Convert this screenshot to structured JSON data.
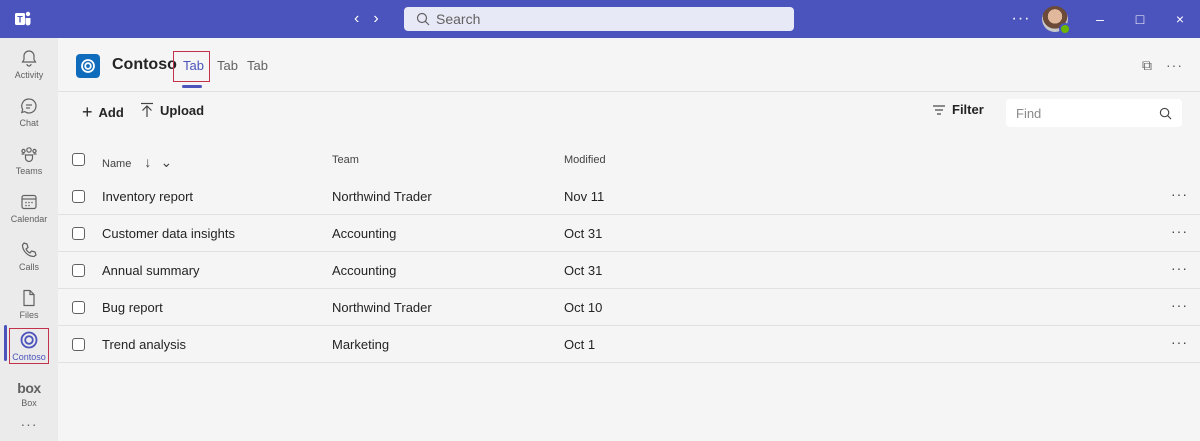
{
  "titlebar": {
    "nav_back": "‹",
    "nav_forward": "›",
    "search_placeholder": "Search",
    "more": "···",
    "minimize": "–",
    "maximize": "□",
    "close": "×"
  },
  "rail": {
    "items": [
      {
        "label": "Activity",
        "icon": "bell-icon"
      },
      {
        "label": "Chat",
        "icon": "chat-icon"
      },
      {
        "label": "Teams",
        "icon": "teams-icon"
      },
      {
        "label": "Calendar",
        "icon": "calendar-icon"
      },
      {
        "label": "Calls",
        "icon": "phone-icon"
      },
      {
        "label": "Files",
        "icon": "file-icon"
      },
      {
        "label": "Contoso",
        "icon": "contoso-icon"
      },
      {
        "label": "Box",
        "icon": "box-logo-icon",
        "text": "box"
      }
    ],
    "more": "···"
  },
  "app": {
    "name": "Contoso",
    "tabs": [
      "Tab",
      "Tab",
      "Tab"
    ],
    "popout": "⧉",
    "more": "···"
  },
  "toolbar": {
    "add_label": "Add",
    "upload_label": "Upload",
    "filter_label": "Filter",
    "find_placeholder": "Find"
  },
  "table": {
    "columns": [
      "Name",
      "Team",
      "Modified"
    ],
    "rows": [
      {
        "name": "Inventory report",
        "team": "Northwind Trader",
        "modified": "Nov 11"
      },
      {
        "name": "Customer data insights",
        "team": "Accounting",
        "modified": "Oct 31"
      },
      {
        "name": "Annual summary",
        "team": "Accounting",
        "modified": "Oct 31"
      },
      {
        "name": "Bug report",
        "team": "Northwind Trader",
        "modified": "Oct 10"
      },
      {
        "name": "Trend analysis",
        "team": "Marketing",
        "modified": "Oct 1"
      }
    ],
    "row_more": "···"
  },
  "colors": {
    "brand": "#4b53bc",
    "app_logo": "#0f6cbd",
    "highlight": "#c4314b"
  }
}
